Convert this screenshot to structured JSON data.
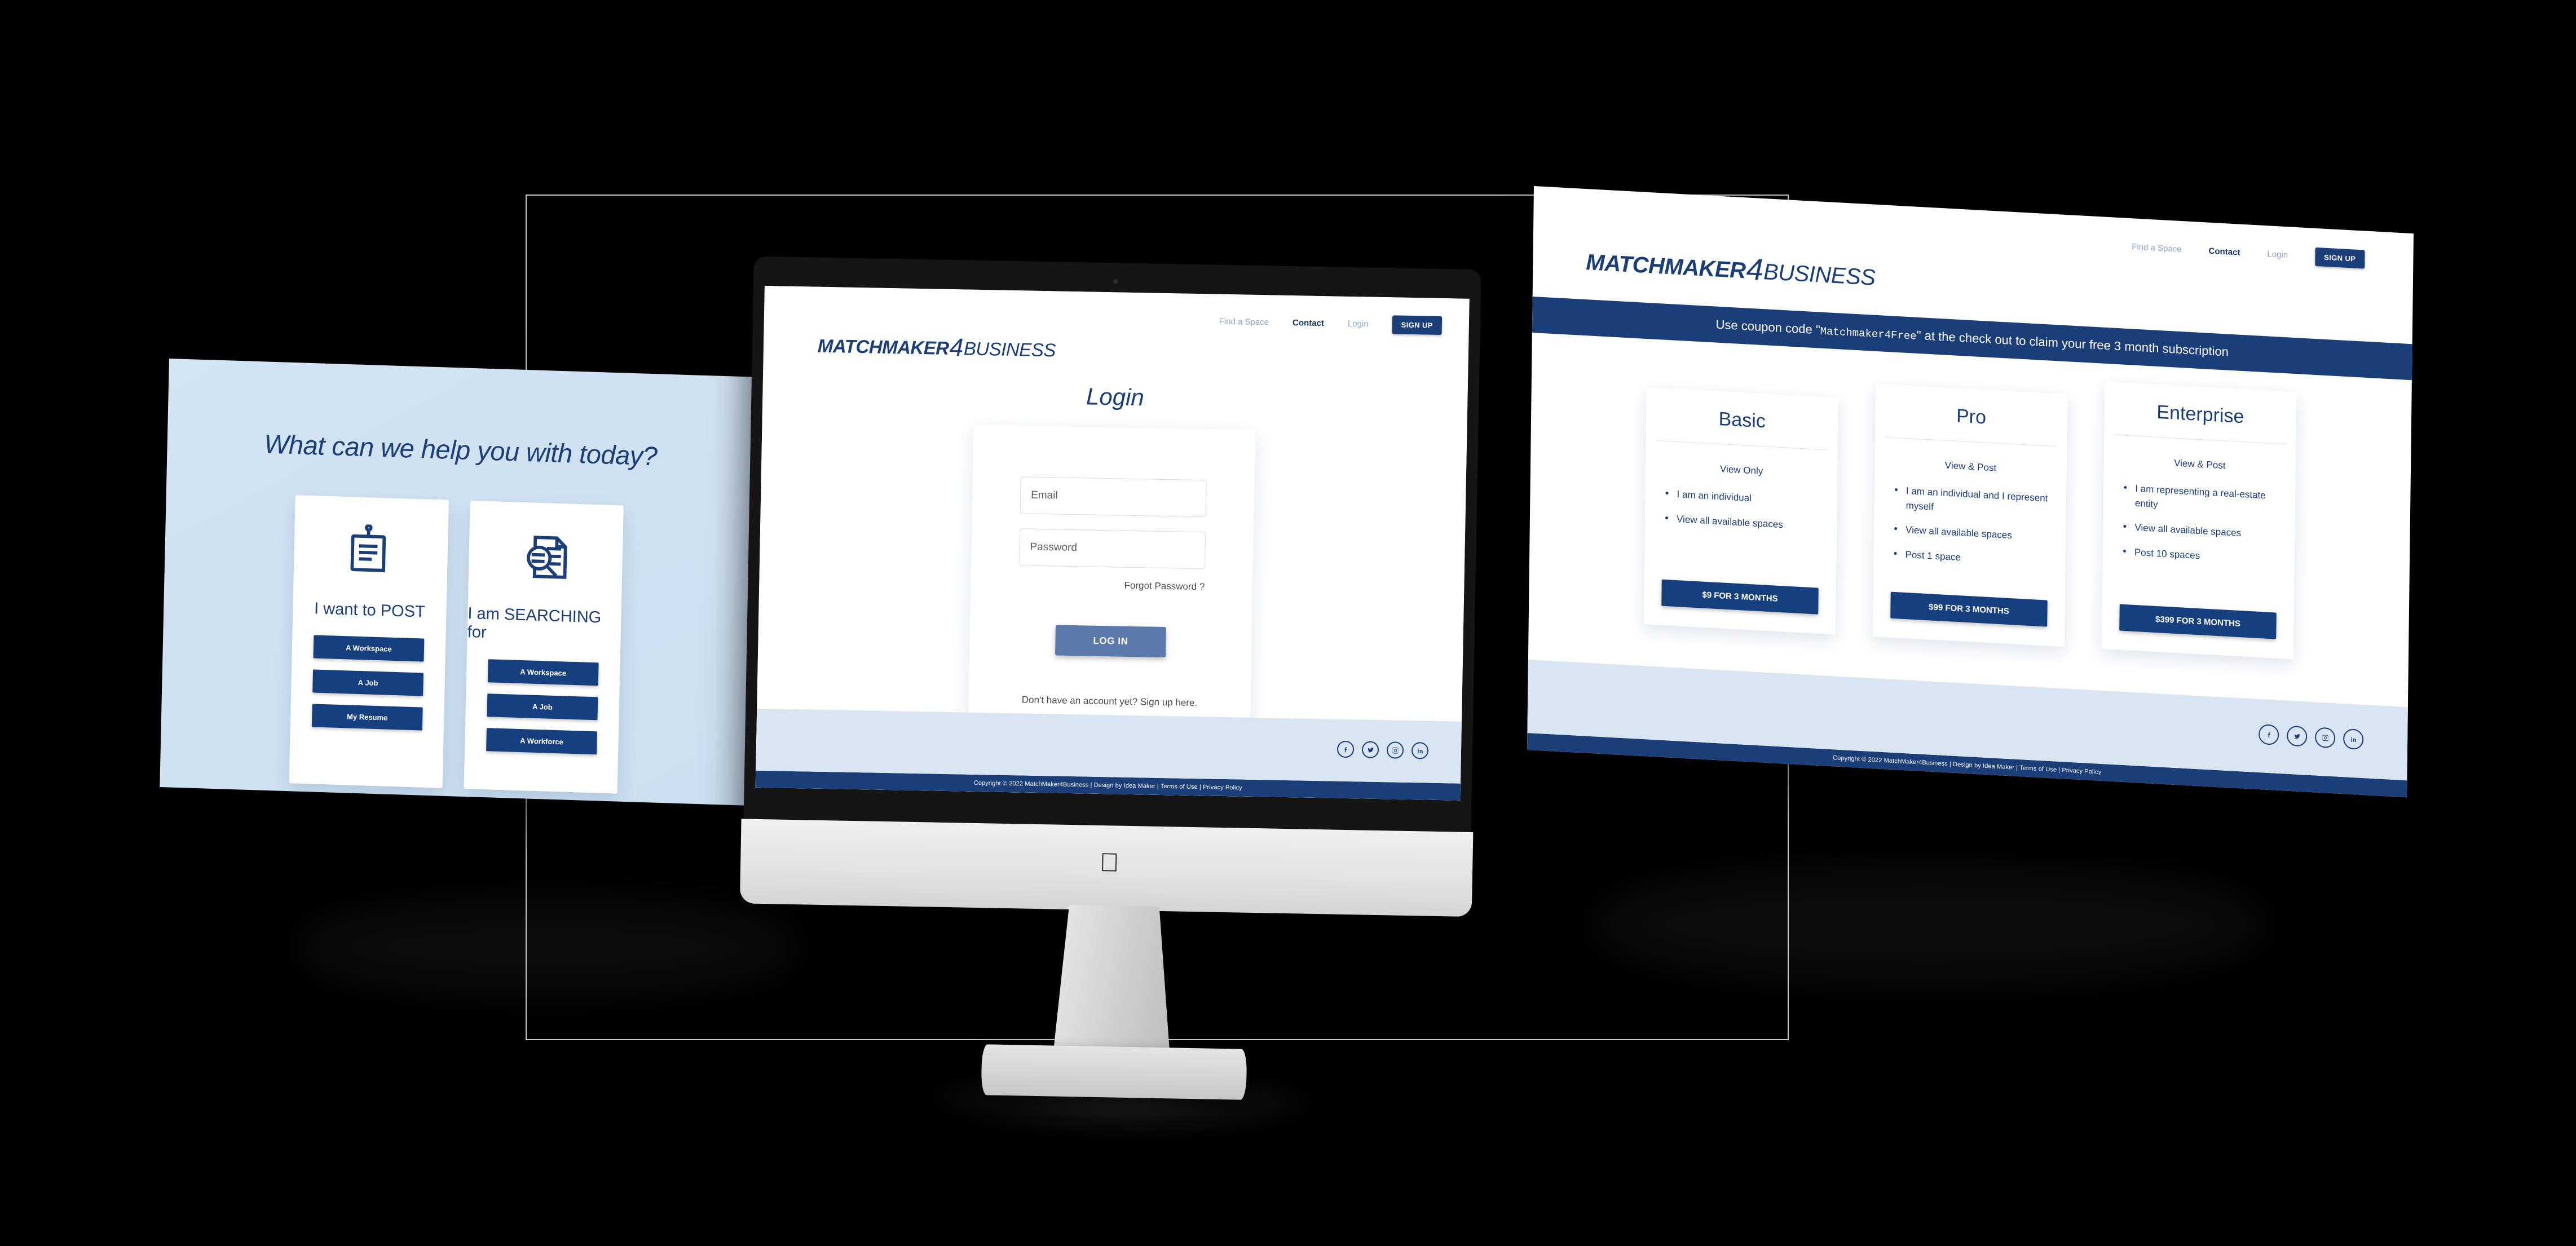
{
  "brand": {
    "logo_part1": "MATCHMAKER",
    "logo_part2": "4",
    "logo_part3": "BUSINESS",
    "accent_dark": "#1b3d78",
    "accent_button": "#16407d",
    "accent_soft_blue": "#d9e6f2",
    "login_button_color": "#5b79ab"
  },
  "nav": {
    "find_a_space": "Find a Space",
    "contact": "Contact",
    "login": "Login",
    "sign_up": "SIGN UP"
  },
  "left_screen": {
    "title": "What can we help you with today?",
    "cards": [
      {
        "icon": "post-document-icon",
        "label": "I want to POST",
        "buttons": [
          "A Workspace",
          "A Job",
          "My Resume"
        ]
      },
      {
        "icon": "search-document-icon",
        "label": "I am SEARCHING for",
        "buttons": [
          "A Workspace",
          "A Job",
          "A Workforce"
        ]
      }
    ]
  },
  "center_screen": {
    "page_title": "Login",
    "email_placeholder": "Email",
    "password_placeholder": "Password",
    "forgot_password": "Forgot Password ?",
    "login_button": "LOG IN",
    "signup_hint": "Don't have an account yet? Sign up here.",
    "footer_copyright": "Copyright © 2022 MatchMaker4Business | Design by Idea Maker | Terms of Use | Privacy Policy",
    "social": [
      "facebook-icon",
      "twitter-icon",
      "instagram-icon",
      "linkedin-icon"
    ]
  },
  "right_screen": {
    "coupon_prefix": "Use coupon code \"",
    "coupon_code": "Matchmaker4Free",
    "coupon_suffix": "\" at the check out to claim your free 3 month subscription",
    "plans": [
      {
        "name": "Basic",
        "subtitle": "View Only",
        "features": [
          "I am an individual",
          "View all available spaces"
        ],
        "cta": "$9 FOR 3 MONTHS"
      },
      {
        "name": "Pro",
        "subtitle": "View & Post",
        "features": [
          "I am an individual and I represent myself",
          "View all available spaces",
          "Post 1 space"
        ],
        "cta": "$99 FOR 3 MONTHS"
      },
      {
        "name": "Enterprise",
        "subtitle": "View & Post",
        "features": [
          "I am representing a real-estate entity",
          "View all available spaces",
          "Post 10 spaces"
        ],
        "cta": "$399 FOR 3 MONTHS"
      }
    ],
    "footer_copyright": "Copyright © 2022 MatchMaker4Business | Design by Idea Maker | Terms of Use | Privacy Policy",
    "social": [
      "facebook-icon",
      "twitter-icon",
      "instagram-icon",
      "linkedin-icon"
    ]
  }
}
